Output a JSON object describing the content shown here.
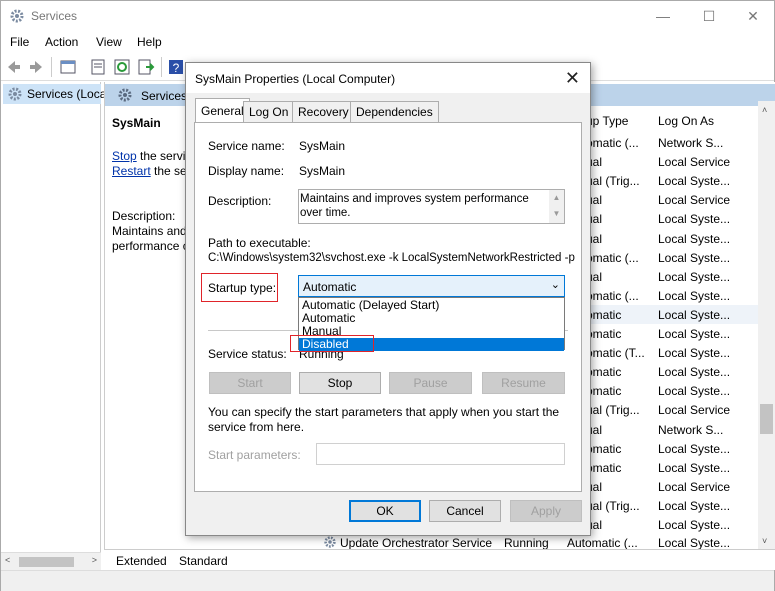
{
  "window": {
    "title": "Services"
  },
  "menu": [
    "File",
    "Action",
    "View",
    "Help"
  ],
  "tree": {
    "node": "Services (Loca"
  },
  "detail": {
    "header": "Services",
    "service_name": "SysMain",
    "stop_link": "Stop",
    "stop_rest": " the servic",
    "restart_link": "Restart",
    "restart_rest": " the ser",
    "desc_label": "Description:",
    "desc_line1": "Maintains and",
    "desc_line2": "performance c"
  },
  "columns": {
    "startup": "up Type",
    "logon": "Log On As"
  },
  "rows": [
    {
      "startup": "omatic (...",
      "logon": "Network S..."
    },
    {
      "startup": "ual",
      "logon": "Local Service"
    },
    {
      "startup": "ual (Trig...",
      "logon": "Local Syste..."
    },
    {
      "startup": "ual",
      "logon": "Local Service"
    },
    {
      "startup": "ual",
      "logon": "Local Syste..."
    },
    {
      "startup": "ual",
      "logon": "Local Syste..."
    },
    {
      "startup": "omatic (...",
      "logon": "Local Syste..."
    },
    {
      "startup": "ual",
      "logon": "Local Syste..."
    },
    {
      "startup": "omatic (...",
      "logon": "Local Syste..."
    },
    {
      "startup": "omatic",
      "logon": "Local Syste..."
    },
    {
      "startup": "omatic",
      "logon": "Local Syste..."
    },
    {
      "startup": "omatic (T...",
      "logon": "Local Syste..."
    },
    {
      "startup": "omatic",
      "logon": "Local Syste..."
    },
    {
      "startup": "omatic",
      "logon": "Local Syste..."
    },
    {
      "startup": "ual (Trig...",
      "logon": "Local Service"
    },
    {
      "startup": "ual",
      "logon": "Network S..."
    },
    {
      "startup": "omatic",
      "logon": "Local Syste..."
    },
    {
      "startup": "omatic",
      "logon": "Local Syste..."
    },
    {
      "startup": "ual",
      "logon": "Local Service"
    },
    {
      "startup": "ual (Trig...",
      "logon": "Local Syste..."
    },
    {
      "startup": "ual",
      "logon": "Local Syste..."
    }
  ],
  "last_row": {
    "name": "Update Orchestrator Service",
    "status": "Running",
    "startup": "Automatic (...",
    "logon": "Local Syste..."
  },
  "view_tabs": {
    "extended": "Extended",
    "standard": "Standard"
  },
  "dialog": {
    "title": "SysMain Properties (Local Computer)",
    "tabs": [
      "General",
      "Log On",
      "Recovery",
      "Dependencies"
    ],
    "service_name_label": "Service name:",
    "service_name_value": "SysMain",
    "display_name_label": "Display name:",
    "display_name_value": "SysMain",
    "description_label": "Description:",
    "description_value": "Maintains and improves system performance over time.",
    "path_label": "Path to executable:",
    "path_value": "C:\\Windows\\system32\\svchost.exe -k LocalSystemNetworkRestricted -p",
    "startup_label": "Startup type:",
    "startup_value": "Automatic",
    "startup_options": [
      "Automatic (Delayed Start)",
      "Automatic",
      "Manual",
      "Disabled"
    ],
    "selected_option": "Disabled",
    "status_label": "Service status:",
    "status_value": "Running",
    "buttons": {
      "start": "Start",
      "stop": "Stop",
      "pause": "Pause",
      "resume": "Resume"
    },
    "hint": "You can specify the start parameters that apply when you start the service from here.",
    "params_label": "Start parameters:",
    "ok": "OK",
    "cancel": "Cancel",
    "apply": "Apply"
  },
  "colors": {
    "accent": "#0078d7",
    "highlight": "#e0242a"
  }
}
